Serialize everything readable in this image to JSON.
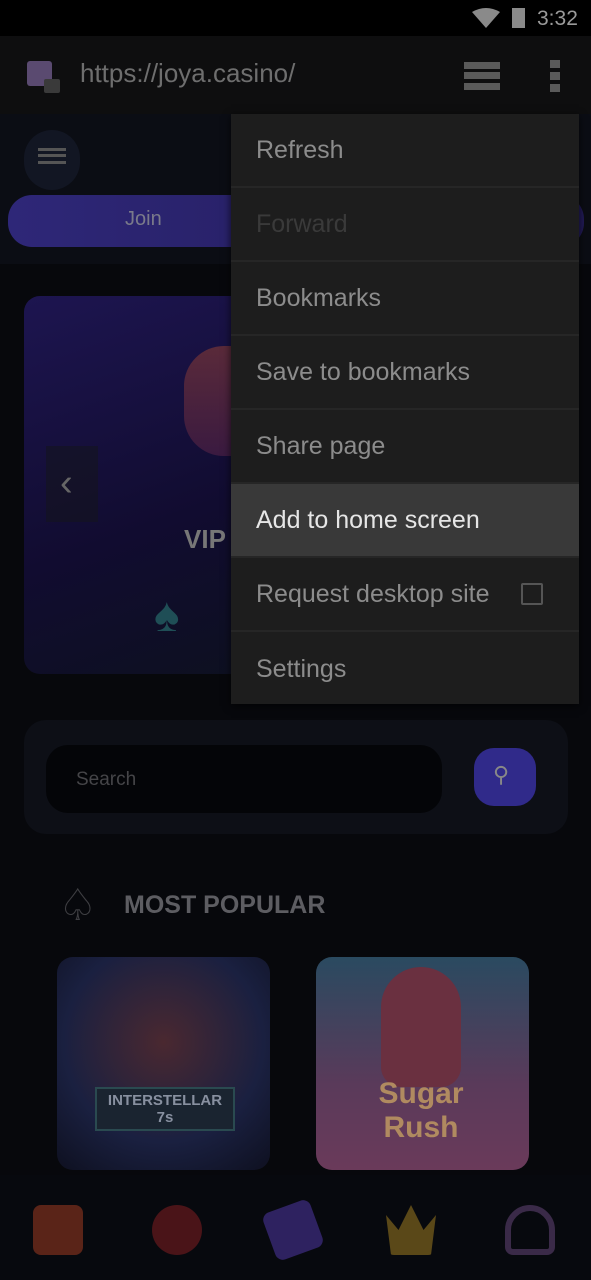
{
  "status": {
    "time": "3:32",
    "icons": [
      "wifi-icon",
      "battery-icon"
    ]
  },
  "browser": {
    "url": "https://joya.casino/",
    "icons": [
      "site-favicon",
      "tabs-icon",
      "more-vert-icon"
    ]
  },
  "site": {
    "join_label": "Join",
    "banner_text": "VIP",
    "search_placeholder": "Search",
    "section_title": "MOST POPULAR",
    "games": [
      "INTERSTELLAR 7s",
      "Sugar Rush"
    ],
    "bottom_nav": [
      "gift-icon",
      "cherry-icon",
      "ticket-icon",
      "crown-icon",
      "headset-icon"
    ]
  },
  "menu": {
    "items": [
      {
        "label": "Refresh",
        "state": "normal"
      },
      {
        "label": "Forward",
        "state": "disabled"
      },
      {
        "label": "Bookmarks",
        "state": "normal"
      },
      {
        "label": "Save to bookmarks",
        "state": "normal"
      },
      {
        "label": "Share page",
        "state": "normal"
      },
      {
        "label": "Add to home screen",
        "state": "highlighted"
      },
      {
        "label": "Request desktop site",
        "state": "normal",
        "checkbox": false
      },
      {
        "label": "Settings",
        "state": "normal"
      }
    ]
  },
  "colors": {
    "accent": "#3b2f9a",
    "menu_bg": "#1d1d1d",
    "highlight": "#393939"
  }
}
